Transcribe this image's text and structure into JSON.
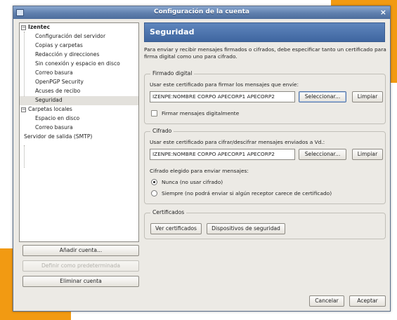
{
  "window": {
    "title": "Configuración de la cuenta",
    "close_glyph": "×"
  },
  "colors": {
    "accent_orange": "#f29a12",
    "header_blue": "#4d72aa",
    "titlebar_blue": "#5f7fad"
  },
  "tree": {
    "account": "Izentec",
    "account_items": [
      "Configuración del servidor",
      "Copias y carpetas",
      "Redacción y direcciones",
      "Sin conexión y espacio en disco",
      "Correo basura",
      "OpenPGP Security",
      "Acuses de recibo",
      "Seguridad"
    ],
    "local": "Carpetas locales",
    "local_items": [
      "Espacio en disco",
      "Correo basura"
    ],
    "smtp": "Servidor de salida (SMTP)"
  },
  "left_buttons": {
    "add": "Añadir cuenta...",
    "set_default": "Definir como predeterminada",
    "remove": "Eliminar cuenta"
  },
  "security": {
    "header": "Seguridad",
    "intro": "Para enviar y recibir mensajes firmados o cifrados, debe especificar tanto un certificado para firma digital como uno para cifrado.",
    "sign": {
      "title": "Firmado digital",
      "label": "Usar este certificado para firmar los mensajes que envíe:",
      "value": "IZENPE:NOMBRE CORPO APECORP1 APECORP2",
      "select": "Seleccionar...",
      "clear": "Limpiar",
      "checkbox": "Firmar mensajes digitalmente"
    },
    "cipher": {
      "title": "Cifrado",
      "label": "Usar este certificado para cifrar/descifrar mensajes enviados a Vd.:",
      "value": "IZENPE:NOMBRE CORPO APECORP1 APECORP2",
      "select": "Seleccionar...",
      "clear": "Limpiar",
      "choice_label": "Cifrado elegido para enviar mensajes:",
      "option_never": "Nunca (no usar cifrado)",
      "option_always": "Siempre (no podrá enviar si algún receptor carece de certificado)"
    },
    "certs": {
      "title": "Certificados",
      "view": "Ver certificados",
      "devices": "Dispositivos de seguridad"
    }
  },
  "footer": {
    "cancel": "Cancelar",
    "accept": "Aceptar"
  }
}
